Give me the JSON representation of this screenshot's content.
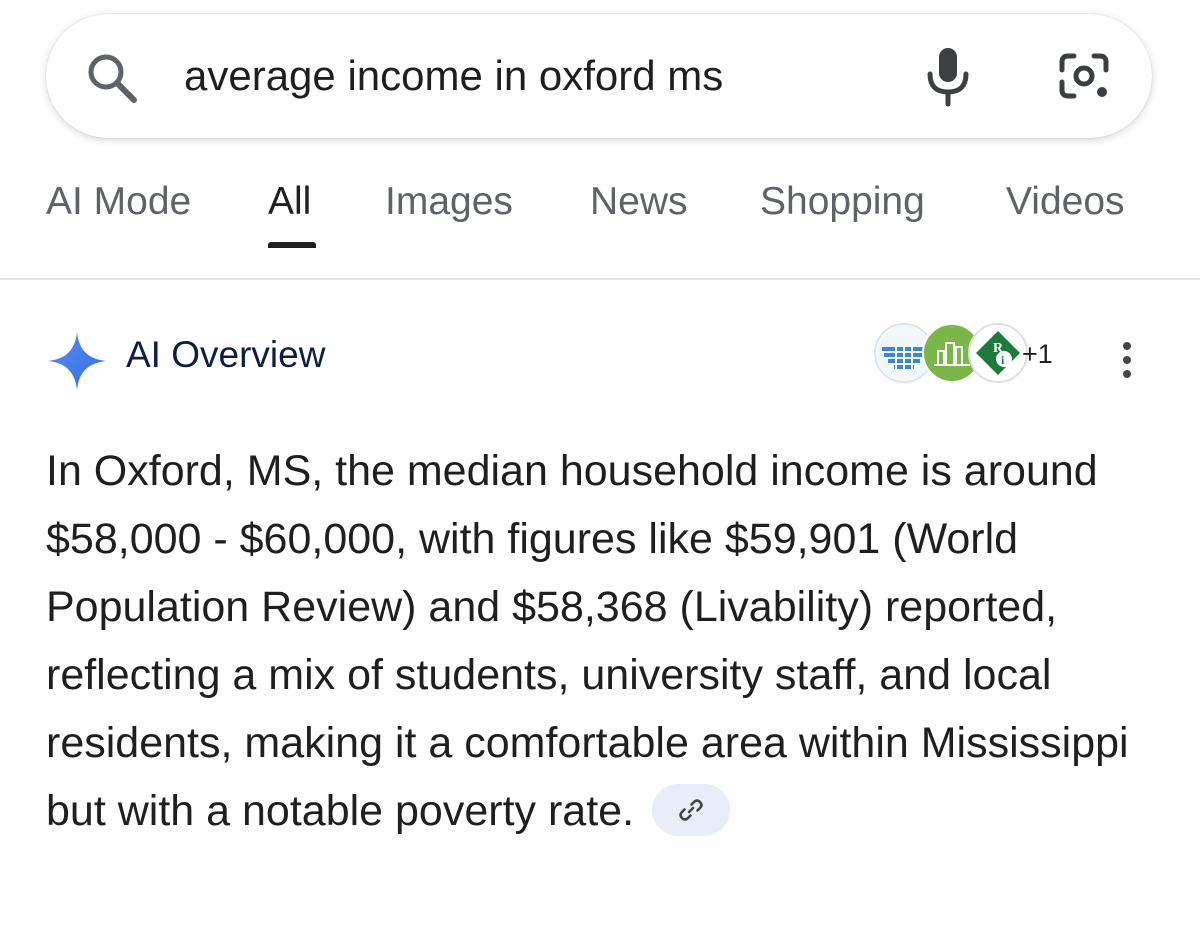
{
  "search": {
    "query": "average income in oxford ms",
    "icons": [
      "search-icon",
      "microphone-icon",
      "google-lens-icon"
    ]
  },
  "tabs": [
    {
      "label": "AI Mode"
    },
    {
      "label": "All",
      "active": true
    },
    {
      "label": "Images"
    },
    {
      "label": "News"
    },
    {
      "label": "Shopping"
    },
    {
      "label": "Videos"
    }
  ],
  "ai_overview": {
    "title": "AI Overview",
    "sources_more": "+1",
    "source_icons": [
      "world-population-review-logo",
      "livability-logo",
      "ri-logo"
    ],
    "body": "In Oxford, MS, the median household income is around $58,000 - $60,000, with figures like $59,901 (World Population Review) and $58,368 (Livability) reported, reflecting a mix of students, university staff, and local residents, making it a comfortable area within Mississippi but with a notable poverty rate.",
    "link_icon": "link-icon"
  },
  "colors": {
    "accent_blue": "#4285f4",
    "title_navy": "#0b1f44",
    "tab_inactive": "#5f6368",
    "chip_background": "#e8edf8"
  }
}
